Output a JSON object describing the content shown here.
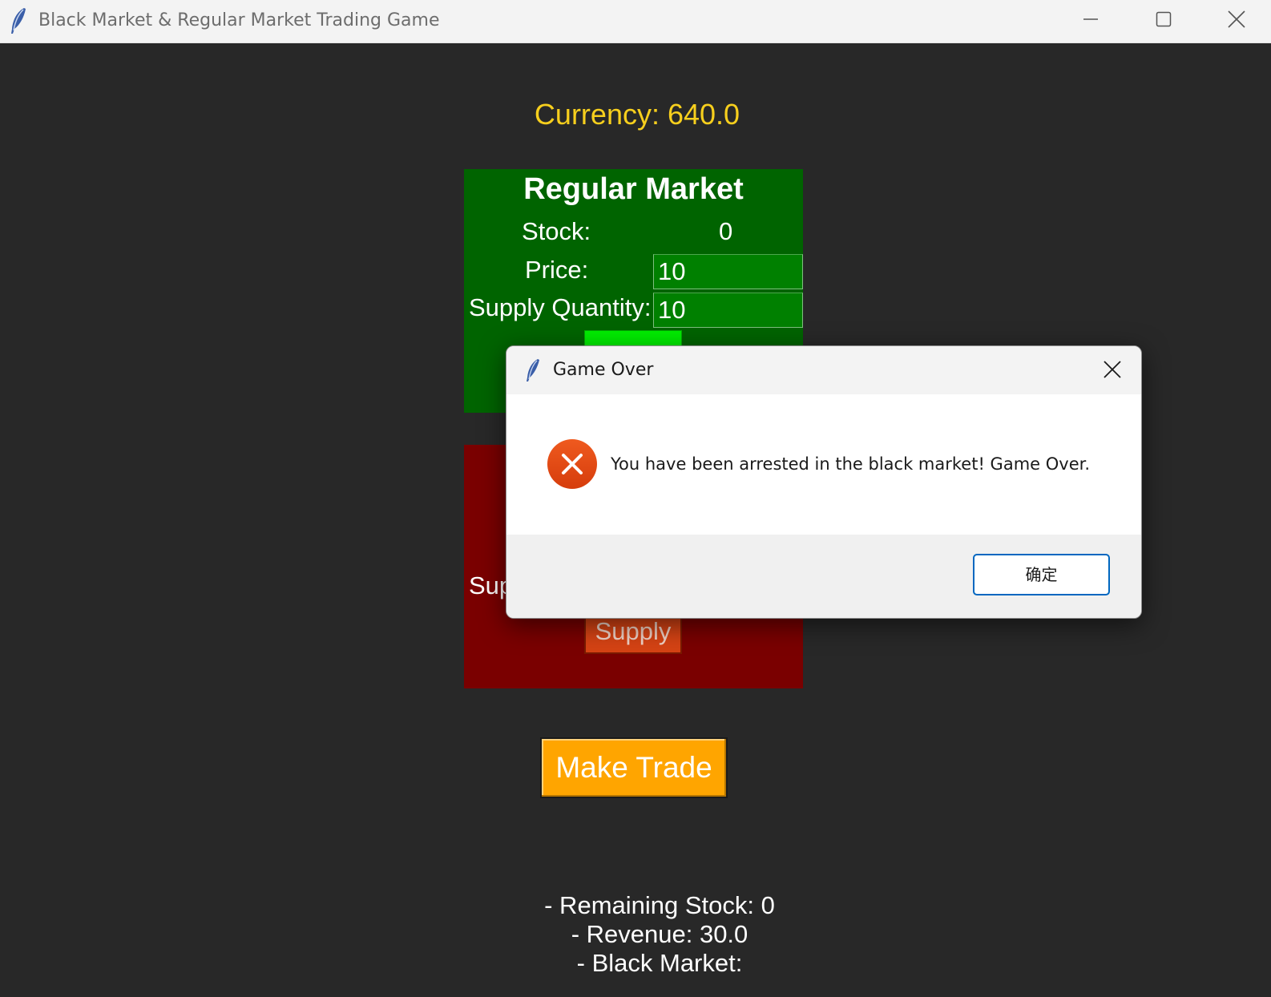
{
  "window": {
    "title": "Black Market & Regular Market Trading Game",
    "icon": "feather-icon"
  },
  "currency": {
    "text": "Currency: 640.0",
    "color": "#f7cf1d"
  },
  "regular_market": {
    "title": "Regular Market",
    "stock_label": "Stock:",
    "stock_value": "0",
    "price_label": "Price:",
    "price_value": "10",
    "supply_quantity_label": "Supply Quantity:",
    "supply_quantity_value": "10",
    "panel_color": "#006400"
  },
  "black_market": {
    "partial_label": "Sup",
    "supply_button_label": "Supply",
    "panel_color": "#7a0000"
  },
  "make_trade_label": "Make Trade",
  "summary": {
    "line1": "- Remaining Stock: 0",
    "line2": "- Revenue: 30.0",
    "line3": "- Black Market:"
  },
  "dialog": {
    "title": "Game Over",
    "icon": "feather-icon",
    "status_icon": "error-icon",
    "message": "You have been arrested in the black market! Game Over.",
    "ok_label": "确定"
  }
}
